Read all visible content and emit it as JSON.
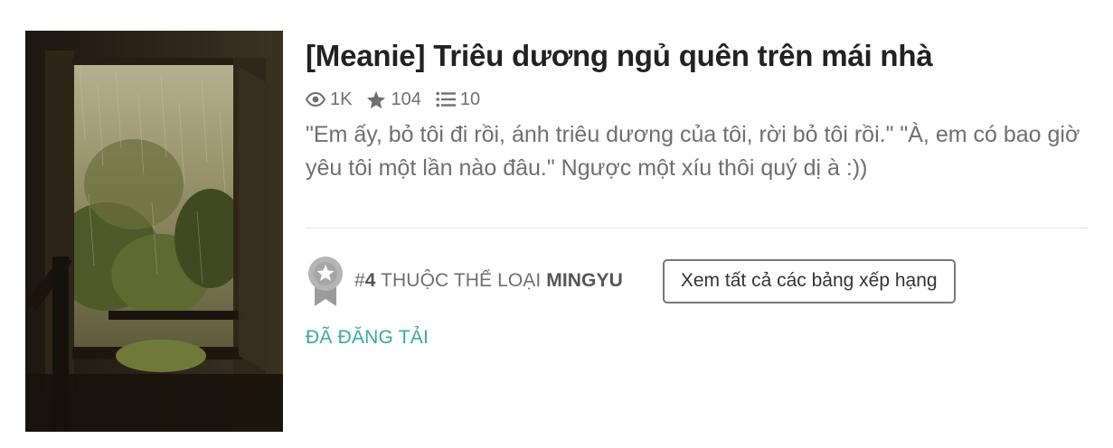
{
  "story": {
    "title": "[Meanie] Triêu dương ngủ quên trên mái nhà",
    "cover_alt": "Rainy window view cover image",
    "stats": {
      "reads": "1K",
      "votes": "104",
      "parts": "10",
      "reads_icon": "eye-icon",
      "votes_icon": "star-icon",
      "parts_icon": "list-icon"
    },
    "description": "\"Em ấy, bỏ tôi đi rồi, ánh triêu dương của tôi, rời bỏ tôi rồi.\" \"À, em có bao giờ yêu tôi một lần nào đâu.\" Ngược một xíu thôi quý dị à :))"
  },
  "ranking": {
    "badge_icon": "ribbon-star-icon",
    "prefix": "#",
    "rank": "4",
    "middle": " THUỘC THỂ LOẠI ",
    "category": "MINGYU",
    "button_label": "Xem tất cả các bảng xếp hạng"
  },
  "status_label": "ĐÃ ĐĂNG TẢI",
  "colors": {
    "accent_teal": "#3aa8a3",
    "text_muted": "#6f6f6f",
    "title": "#222222"
  }
}
